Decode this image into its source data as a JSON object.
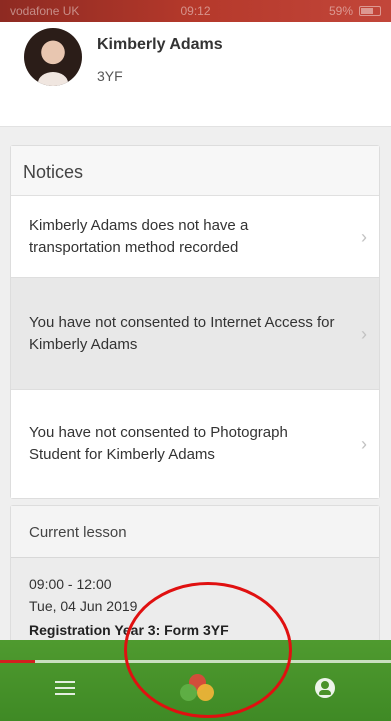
{
  "status_bar": {
    "carrier": "vodafone UK",
    "time": "09:12",
    "battery": "59%"
  },
  "profile": {
    "name": "Kimberly Adams",
    "form": "3YF"
  },
  "notices": {
    "title": "Notices",
    "items": [
      {
        "text": "Kimberly Adams does not have a transportation method recorded"
      },
      {
        "text": "You have not consented to Internet Access for Kimberly Adams"
      },
      {
        "text": "You have not consented to Photograph Student for Kimberly Adams"
      }
    ]
  },
  "lesson": {
    "title": "Current lesson",
    "time": "09:00 - 12:00",
    "date": "Tue, 04 Jun 2019",
    "registration": "Registration Year 3: Form 3YF"
  },
  "bottom_nav": {
    "progress": 0.09,
    "items": [
      {
        "icon": "menu-icon"
      },
      {
        "icon": "app-logo-icon"
      },
      {
        "icon": "profile-icon"
      }
    ]
  },
  "colors": {
    "status_bar": "#b5392b",
    "nav_bar": "#4a922a",
    "annotation": "#e01010"
  }
}
